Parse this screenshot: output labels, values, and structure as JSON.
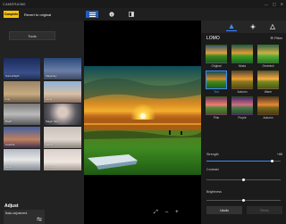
{
  "window": {
    "title": "CAMERA360",
    "controls": [
      "—",
      "▢",
      "✕"
    ]
  },
  "toolbar": {
    "complete_label": "Complete",
    "revert_label": "Revert to original"
  },
  "left": {
    "tools_label": "Tools",
    "filters": [
      "SunnyNight",
      "Magicsky",
      "Fog",
      "Lavel",
      "B&W",
      "Magic Skin",
      "Colorful",
      "Sketch",
      "Glow",
      "Inverse"
    ],
    "adjust_title": "Adjust",
    "basic_adjustment_label": "Basic adjustment"
  },
  "right": {
    "category_title": "LOMO",
    "filter_label": "Filter",
    "presets": [
      "Original",
      "Moda",
      "Greenish",
      "Teal",
      "Autumn",
      "Warm",
      "Pink",
      "Purple",
      "Autumn"
    ],
    "selected_preset": "Teal",
    "sliders": [
      {
        "label": "Strength",
        "value": "+88",
        "level": 0.88
      },
      {
        "label": "Contrast",
        "value": "0",
        "level": 0.5
      },
      {
        "label": "Brightness",
        "value": "0",
        "level": 0.5
      }
    ],
    "undo_label": "Undo",
    "redo_label": "Redo"
  },
  "center": {
    "bottom_icons": [
      "⤢",
      "–",
      "+"
    ]
  },
  "colors": {
    "accent": "#3d8bff",
    "complete": "#f4c20d"
  }
}
